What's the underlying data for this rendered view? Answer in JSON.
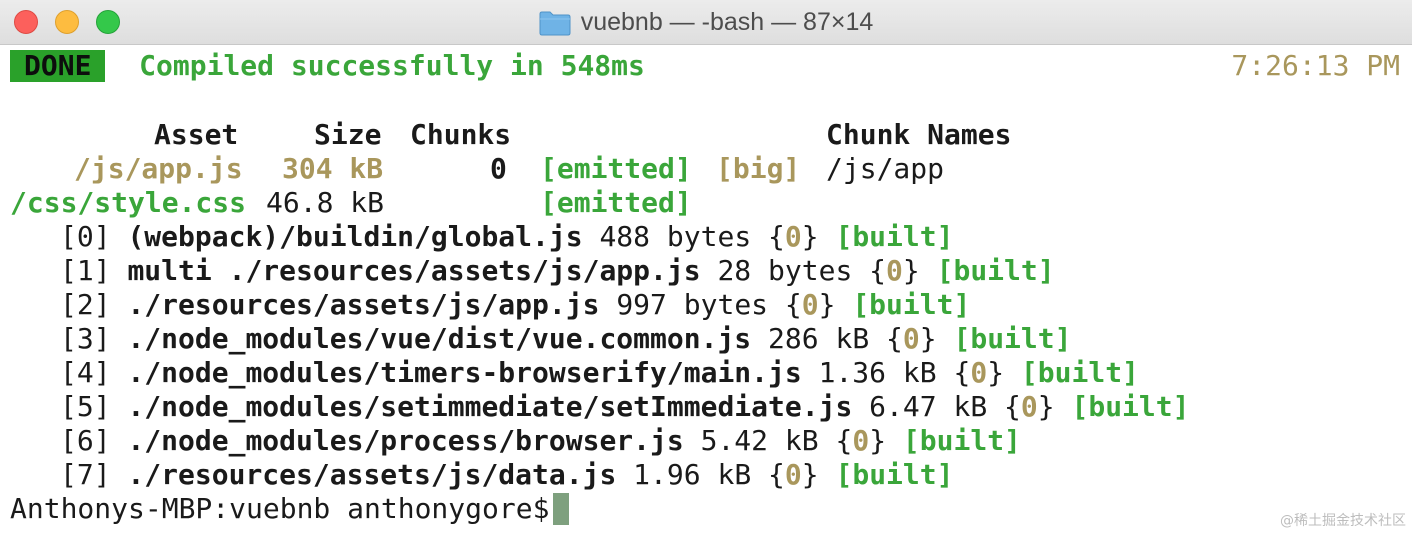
{
  "window": {
    "title": "vuebnb — -bash — 87×14",
    "icon": "folder-icon"
  },
  "status": {
    "badge": "DONE",
    "message": "Compiled successfully in 548ms",
    "time": "7:26:13 PM"
  },
  "assets_table": {
    "headers": {
      "asset": "Asset",
      "size": "Size",
      "chunks": "Chunks",
      "chunk_names": "Chunk Names"
    },
    "rows": [
      {
        "asset": "/js/app.js",
        "size": "304 kB",
        "chunks": "0",
        "emitted": "[emitted]",
        "big": "[big]",
        "chunk_name": "/js/app"
      },
      {
        "asset": "/css/style.css",
        "size": "46.8 kB",
        "chunks": "",
        "emitted": "[emitted]",
        "big": "",
        "chunk_name": ""
      }
    ]
  },
  "modules": [
    {
      "index": "[0]",
      "path": "(webpack)/buildin/global.js",
      "size": "488 bytes",
      "chunk": "0",
      "status": "[built]"
    },
    {
      "index": "[1]",
      "path": "multi ./resources/assets/js/app.js",
      "size": "28 bytes",
      "chunk": "0",
      "status": "[built]"
    },
    {
      "index": "[2]",
      "path": "./resources/assets/js/app.js",
      "size": "997 bytes",
      "chunk": "0",
      "status": "[built]"
    },
    {
      "index": "[3]",
      "path": "./node_modules/vue/dist/vue.common.js",
      "size": "286 kB",
      "chunk": "0",
      "status": "[built]"
    },
    {
      "index": "[4]",
      "path": "./node_modules/timers-browserify/main.js",
      "size": "1.36 kB",
      "chunk": "0",
      "status": "[built]"
    },
    {
      "index": "[5]",
      "path": "./node_modules/setimmediate/setImmediate.js",
      "size": "6.47 kB",
      "chunk": "0",
      "status": "[built]"
    },
    {
      "index": "[6]",
      "path": "./node_modules/process/browser.js",
      "size": "5.42 kB",
      "chunk": "0",
      "status": "[built]"
    },
    {
      "index": "[7]",
      "path": "./resources/assets/js/data.js",
      "size": "1.96 kB",
      "chunk": "0",
      "status": "[built]"
    }
  ],
  "prompt": "Anthonys-MBP:vuebnb anthonygore$",
  "watermark": "@稀土掘金技术社区",
  "colors": {
    "done_badge": "#2aa12a",
    "success_text": "#3aa63a",
    "time_text": "#a9975c",
    "big_tag": "#a38a3e",
    "cursor": "#7ea07e"
  }
}
